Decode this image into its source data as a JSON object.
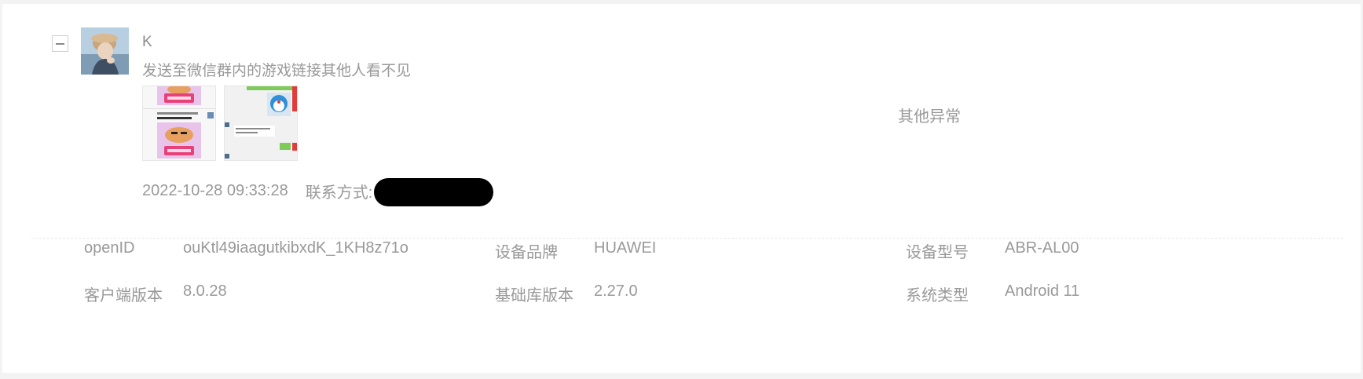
{
  "feedback": {
    "username": "K",
    "message": "发送至微信群内的游戏链接其他人看不见",
    "category": "其他异常",
    "timestamp": "2022-10-28 09:33:28",
    "contact_label": "联系方式:",
    "thumbnails": [
      {
        "name": "screenshot-1",
        "button_text": "加入游戏"
      },
      {
        "name": "screenshot-2",
        "button_text": "分享"
      }
    ]
  },
  "details": {
    "openid_label": "openID",
    "openid_value": "ouKtl49iaagutkibxdK_1KH8z71o",
    "brand_label": "设备品牌",
    "brand_value": "HUAWEI",
    "model_label": "设备型号",
    "model_value": "ABR-AL00",
    "client_version_label": "客户端版本",
    "client_version_value": "8.0.28",
    "lib_version_label": "基础库版本",
    "lib_version_value": "2.27.0",
    "os_label": "系统类型",
    "os_value": "Android 11"
  },
  "colors": {
    "background": "#f3f3f3",
    "card": "#ffffff",
    "text": "#999999",
    "redaction": "#000000"
  }
}
